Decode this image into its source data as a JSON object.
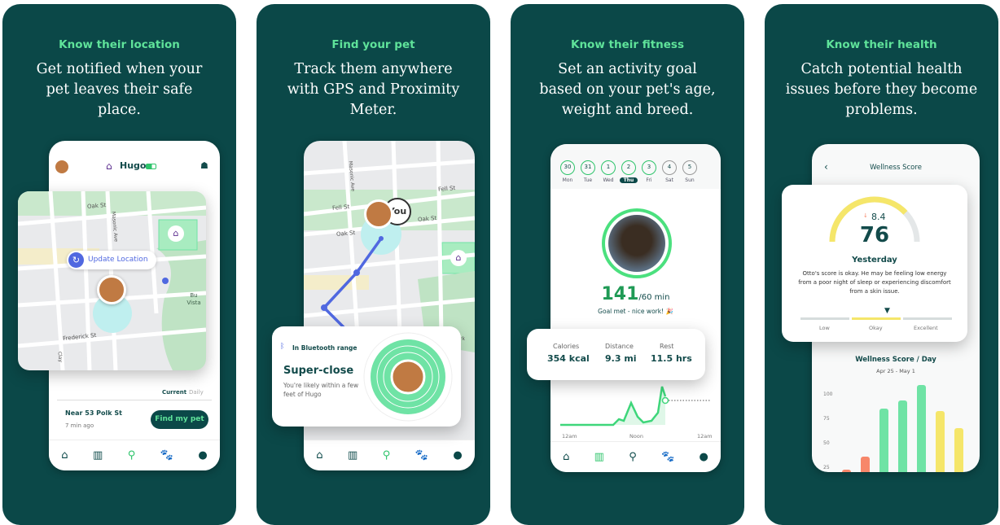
{
  "panels": [
    {
      "kicker": "Know their location",
      "headline": "Get notified when your pet leaves their safe place.",
      "pet_name": "Hugo",
      "update_label": "Update Location",
      "streets": {
        "oak": "Oak St",
        "masonic": "Masonic Ave",
        "frederick": "Frederick St",
        "clay": "Clay",
        "buena": "Bu Vista"
      },
      "tabs": [
        "Current",
        "Daily"
      ],
      "address": "Near 53 Polk St",
      "time_ago": "7 min ago",
      "find_label": "Find my pet"
    },
    {
      "kicker": "Find your pet",
      "headline": "Track them anywhere with GPS and Proximity Meter.",
      "streets": {
        "fell": "Fell St",
        "fell2": "Fell St",
        "oak": "Oak St",
        "oak2": "Oak St",
        "masonic": "Masonic Ave",
        "park": "Park"
      },
      "you_label": "You",
      "bt_label": "In Bluetooth range",
      "proximity_title": "Super-close",
      "proximity_desc": "You're likely within a few feet of Hugo"
    },
    {
      "kicker": "Know their fitness",
      "headline": "Set an activity goal based on your pet's age, weight and breed.",
      "days": [
        {
          "n": "30",
          "d": "Mon"
        },
        {
          "n": "31",
          "d": "Tue"
        },
        {
          "n": "1",
          "d": "Wed"
        },
        {
          "n": "2",
          "d": "Thu"
        },
        {
          "n": "3",
          "d": "Fri"
        },
        {
          "n": "4",
          "d": "Sat"
        },
        {
          "n": "5",
          "d": "Sun"
        }
      ],
      "selected_day": "Thu",
      "activity_minutes": "141",
      "goal": "/60 min",
      "goal_msg": "Goal met - nice work! 🎉",
      "stats": [
        {
          "label": "Calories",
          "value": "354 kcal"
        },
        {
          "label": "Distance",
          "value": "9.3 mi"
        },
        {
          "label": "Rest",
          "value": "11.5 hrs"
        }
      ],
      "chart_labels": [
        "12am",
        "Noon",
        "12am"
      ]
    },
    {
      "kicker": "Know their health",
      "headline": "Catch potential health issues before they become problems.",
      "screen_title": "Wellness Score",
      "delta": "8.4",
      "score": "76",
      "score_max": 100,
      "period": "Yesterday",
      "description": "Otto's score is okay. He may be feeling low energy from a poor night of sleep or experiencing discomfort from a skin issue.",
      "levels": [
        "Low",
        "Okay",
        "Excellent"
      ],
      "current_level": "Okay"
    }
  ],
  "nav_icons": [
    "home-icon",
    "activity-icon",
    "location-icon",
    "paw-icon",
    "profile-icon"
  ],
  "colors": {
    "panel_bg": "#0b4848",
    "accent_green": "#5fe39a",
    "activity_green": "#2ec46b",
    "yellow": "#f5e66a",
    "coral": "#f7876a",
    "purple": "#5b2d8e",
    "blue": "#5068e0"
  },
  "chart_data": {
    "type": "bar",
    "title": "Wellness Score / Day",
    "subtitle": "Apr 25 - May 1",
    "yticks": [
      25,
      50,
      75,
      100
    ],
    "values": [
      23,
      37,
      86,
      94,
      110,
      83,
      66
    ],
    "colors": [
      "#f7876a",
      "#f7876a",
      "#6fe3a5",
      "#6fe3a5",
      "#6fe3a5",
      "#f5e66a",
      "#f5e66a"
    ]
  }
}
